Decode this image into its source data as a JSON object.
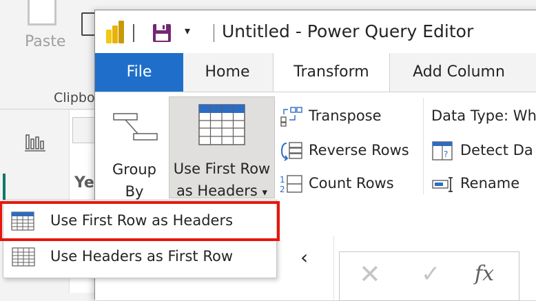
{
  "background_app": {
    "paste_label": "Paste",
    "clipboard_group_label": "Clipbo",
    "partial_table_text": "Ye"
  },
  "editor": {
    "window_title": "Untitled - Power Query Editor",
    "qat_dropdown_glyph": "▾",
    "tabs": [
      {
        "label": "File",
        "selected": false
      },
      {
        "label": "Home",
        "selected": false
      },
      {
        "label": "Transform",
        "selected": true
      },
      {
        "label": "Add Column",
        "selected": false
      }
    ],
    "ribbon": {
      "group_by": {
        "label_line1": "Group",
        "label_line2": "By"
      },
      "use_first_row": {
        "label_line1": "Use First Row",
        "label_line2": "as Headers",
        "dropdown_glyph": "▾"
      },
      "table_buttons": [
        {
          "label": "Transpose",
          "icon": "transpose-icon"
        },
        {
          "label": "Reverse Rows",
          "icon": "reverse-rows-icon"
        },
        {
          "label": "Count Rows",
          "icon": "count-rows-icon"
        }
      ],
      "column_buttons": [
        {
          "label": "Data Type: Wh",
          "icon": ""
        },
        {
          "label": "Detect Da",
          "icon": "detect-data-type-icon"
        },
        {
          "label": "Rename",
          "icon": "rename-icon"
        }
      ]
    },
    "collapse_glyph": "‹",
    "formula_bar": {
      "cancel_glyph": "✕",
      "confirm_glyph": "✓",
      "fx_label": "fx",
      "eq_glyph": "="
    }
  },
  "dropdown_menu": {
    "items": [
      {
        "label": "Use First Row as Headers",
        "highlighted": true
      },
      {
        "label": "Use Headers as First Row",
        "highlighted": false
      }
    ]
  },
  "colors": {
    "file_tab": "#1f6fca",
    "highlight_box": "#e8160c",
    "powerbi_yellow": "#f2c811",
    "save_icon_purple": "#742774"
  }
}
